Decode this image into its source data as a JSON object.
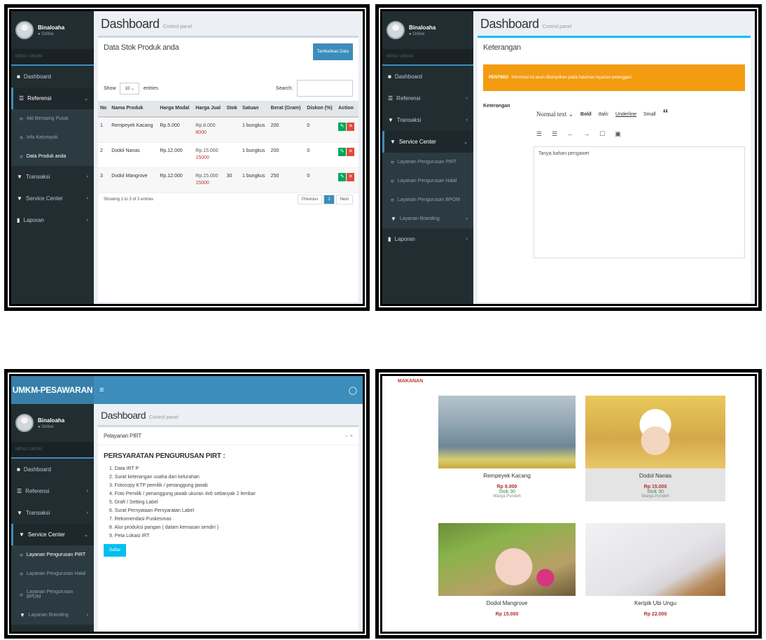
{
  "app": {
    "logo": "UMKM-PESAWARAN",
    "user_name": "Binaloaha",
    "user_status": "● Online",
    "nav_header": "MENU UMUM",
    "page_title": "Dashboard",
    "page_subtitle": "Control panel"
  },
  "panel1": {
    "nav": [
      "Dashboard",
      "Referensi",
      "Akt Bersaing Pusat",
      "Info Kelompok",
      "Data Produk anda",
      "Transaksi",
      "Service Center",
      "Laporan"
    ],
    "box_title": "Data Stok Produk anda",
    "add_button": "Tambahkan Data",
    "show_label": "Show",
    "show_value": "10",
    "entries_label": "entries",
    "search_label": "Search:",
    "columns": [
      "No",
      "Nama Produk",
      "Harga Modal",
      "Harga Jual",
      "Stok",
      "Satuan",
      "Berat (Gram)",
      "Diskon (%)",
      "Action"
    ],
    "rows": [
      {
        "no": "1",
        "nama": "Rempeyek Kacang",
        "modal": "Rp.5.000",
        "jual": "Rp.8.000",
        "jual2": "8000",
        "stok": "",
        "satuan": "1 bungkus",
        "berat": "200",
        "diskon": "0"
      },
      {
        "no": "2",
        "nama": "Dodol Nanas",
        "modal": "Rp.12.000",
        "jual": "Rp.15.000",
        "jual2": "15000",
        "stok": "",
        "satuan": "1 bungkus",
        "berat": "200",
        "diskon": "0"
      },
      {
        "no": "3",
        "nama": "Dodol Mangrove",
        "modal": "Rp.12.000",
        "jual": "Rp.15.000",
        "jual2": "15000",
        "stok": "30",
        "satuan": "1 bungkus",
        "berat": "250",
        "diskon": "0"
      }
    ],
    "footer_info": "Showing 1 to 3 of 3 entries",
    "prev": "Previous",
    "page": "1",
    "next": "Next"
  },
  "panel2": {
    "nav": [
      "Dashboard",
      "Referensi",
      "Transaksi",
      "Service Center",
      "Layanan Pengurusan PIRT",
      "Layanan Pengurusan Halal",
      "Layanan Pengurusan BPOM",
      "Layanan Branding",
      "Laporan"
    ],
    "box_title": "Keterangan",
    "alert_bold": "PENTING!",
    "alert_text": "Informasi ini akan ditampilkan pada halaman layanan pelanggan",
    "form_label": "Keterangan",
    "toolbar": [
      "Normal text",
      "Bold",
      "Italic",
      "Underline",
      "Small"
    ],
    "quote": "“",
    "toolbar2": [
      "☰",
      "☰",
      "←",
      "→",
      "☐",
      "▣"
    ],
    "placeholder": "Tanya bahan pengawet"
  },
  "panel3": {
    "menu_icon": "≡",
    "nav": [
      "Dashboard",
      "Referensi",
      "Transaksi",
      "Service Center",
      "Layanan Pengurusan PIRT",
      "Layanan Pengurusan Halal",
      "Layanan Pengurusan BPOM",
      "Layanan Branding"
    ],
    "box_title": "Pelayanan PIRT",
    "box_tools": "– ×",
    "req_title": "PERSYARATAN PENGURUSAN PIRT :",
    "requirements": [
      "1. Data IRT P",
      "2. Surat keterangan usaha dari kelurahan",
      "3. Fotocopy KTP pemilik / penanggung jawab",
      "4. Foto Pemilik / penanggung jawab ukuran 4x6 sebanyak 2 lembar",
      "5. Draft / Setting Label",
      "6. Surat Pernyataan Persyaratan Label",
      "7. Rekomendasi Puskesmas",
      "8. Alur produksi pangan ( dalam kemasan sendiri )",
      "9. Peta Lokasi IRT"
    ],
    "button": "Daftar"
  },
  "panel4": {
    "category": "MAKANAN",
    "products": [
      {
        "name": "Rempeyek Kacang",
        "price": "Rp 8.000",
        "stock": "Stok 30",
        "loc": "Warga Pundeh"
      },
      {
        "name": "Dodol Nanas",
        "price": "Rp 15.000",
        "stock": "Stok 30",
        "loc": "Warga Pundeh"
      },
      {
        "name": "Dodol Mangrove",
        "price": "Rp 15.000",
        "stock": "",
        "loc": ""
      },
      {
        "name": "Keripik Ubi Ungu",
        "price": "Rp 22.000",
        "stock": "",
        "loc": ""
      }
    ]
  },
  "colors": {
    "sidebar": "#222d32",
    "primary": "#3c8dbc",
    "warning": "#f39c12",
    "info": "#00c0ef",
    "success": "#00a65a",
    "danger": "#dd4b39"
  }
}
